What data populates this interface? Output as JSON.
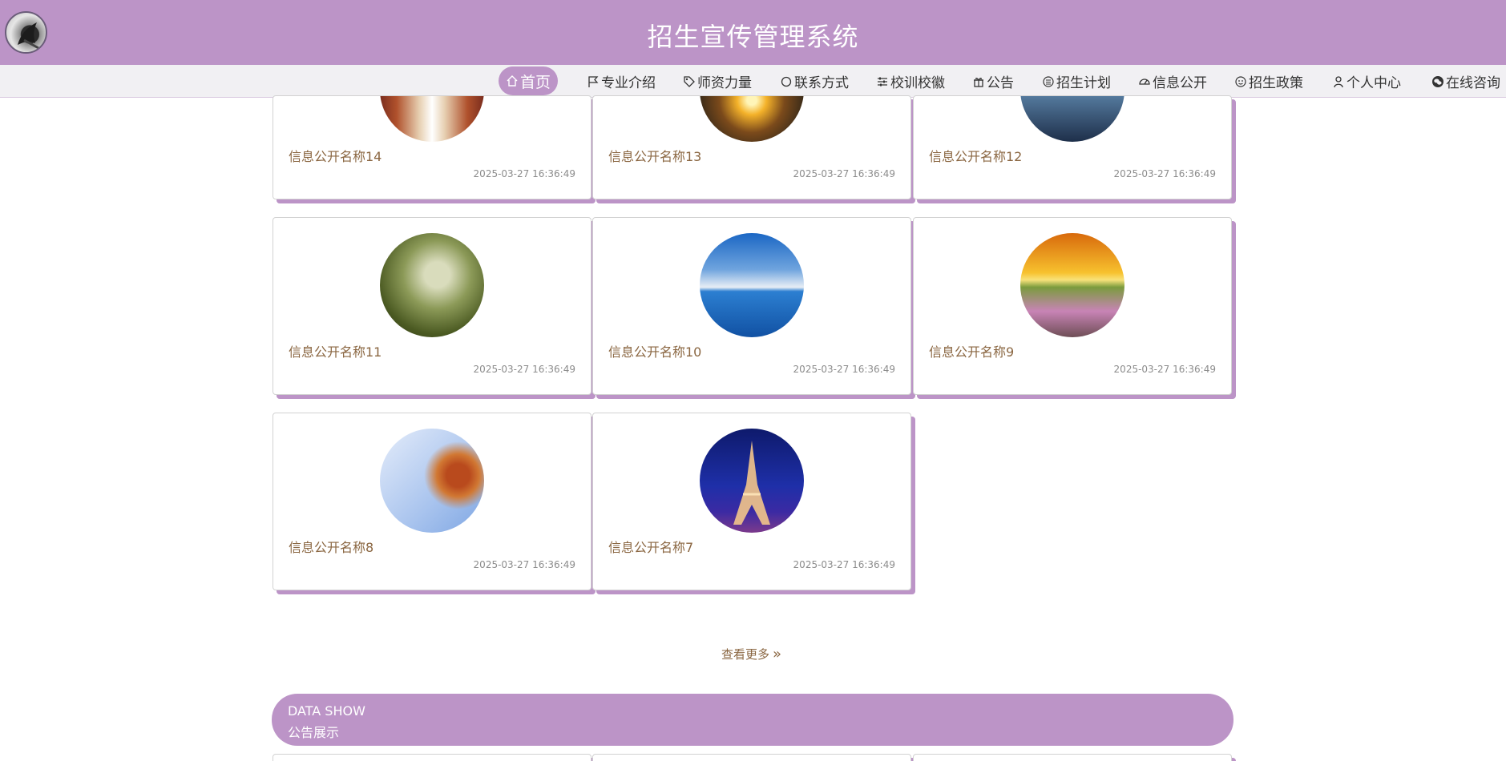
{
  "header": {
    "title": "招生宣传管理系统",
    "brand_color": "#bc94c7"
  },
  "nav": {
    "items": [
      {
        "label": "首页",
        "icon": "home-icon",
        "active": true
      },
      {
        "label": "专业介绍",
        "icon": "flag-icon"
      },
      {
        "label": "师资力量",
        "icon": "tag-icon"
      },
      {
        "label": "联系方式",
        "icon": "circle-icon"
      },
      {
        "label": "校训校徽",
        "icon": "sliders-icon"
      },
      {
        "label": "公告",
        "icon": "gift-icon"
      },
      {
        "label": "招生计划",
        "icon": "printer-icon"
      },
      {
        "label": "信息公开",
        "icon": "gauge-icon"
      },
      {
        "label": "招生政策",
        "icon": "smile-icon"
      },
      {
        "label": "个人中心",
        "icon": "user-icon"
      },
      {
        "label": "在线咨询",
        "icon": "wechat-icon"
      }
    ]
  },
  "info_list": {
    "items": [
      {
        "name": "信息公开名称14",
        "time": "2025-03-27 16:36:49",
        "image": "corridor-photo"
      },
      {
        "name": "信息公开名称13",
        "time": "2025-03-27 16:36:49",
        "image": "road-sunset-photo"
      },
      {
        "name": "信息公开名称12",
        "time": "2025-03-27 16:36:49",
        "image": "city-night-photo"
      },
      {
        "name": "信息公开名称11",
        "time": "2025-03-27 16:36:49",
        "image": "forest-path-photo"
      },
      {
        "name": "信息公开名称10",
        "time": "2025-03-27 16:36:49",
        "image": "ocean-sky-photo"
      },
      {
        "name": "信息公开名称9",
        "time": "2025-03-27 16:36:49",
        "image": "flower-sunset-photo"
      },
      {
        "name": "信息公开名称8",
        "time": "2025-03-27 16:36:49",
        "image": "autumn-leaves-photo"
      },
      {
        "name": "信息公开名称7",
        "time": "2025-03-27 16:36:49",
        "image": "eiffel-tower-photo"
      }
    ],
    "more_label": "查看更多"
  },
  "data_show": {
    "en_label": "DATA SHOW",
    "cn_label": "公告展示"
  }
}
